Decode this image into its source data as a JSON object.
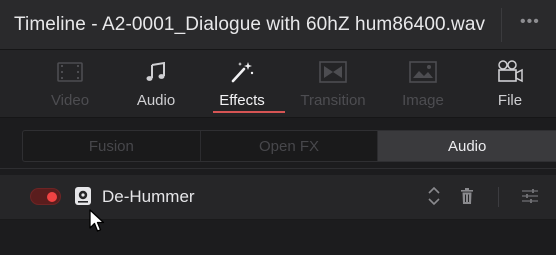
{
  "window": {
    "title": "Timeline - A2-0001_Dialogue with 60hZ hum86400.wav",
    "more_label": "•••"
  },
  "tabs": [
    {
      "label": "Video",
      "icon": "video-icon",
      "state": "disabled"
    },
    {
      "label": "Audio",
      "icon": "music-note-icon",
      "state": "enabled"
    },
    {
      "label": "Effects",
      "icon": "magic-wand-icon",
      "state": "active"
    },
    {
      "label": "Transition",
      "icon": "transition-icon",
      "state": "disabled"
    },
    {
      "label": "Image",
      "icon": "image-icon",
      "state": "disabled"
    },
    {
      "label": "File",
      "icon": "file-projector-icon",
      "state": "enabled"
    }
  ],
  "subtabs": [
    {
      "label": "Fusion",
      "state": "disabled"
    },
    {
      "label": "Open FX",
      "state": "disabled"
    },
    {
      "label": "Audio",
      "state": "active"
    }
  ],
  "effect": {
    "name": "De-Hummer",
    "enabled": true,
    "icon": "audio-plugin-icon"
  },
  "colors": {
    "accent": "#d65454",
    "toggle_on": "#f04343",
    "background": "#1c1c1e"
  }
}
